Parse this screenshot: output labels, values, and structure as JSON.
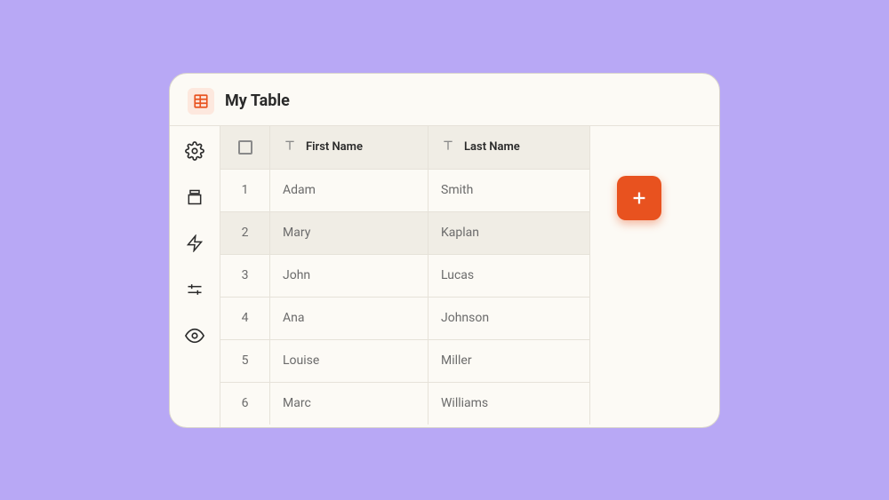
{
  "title": "My Table",
  "columns": {
    "first": "First Name",
    "last": "Last Name"
  },
  "rows": [
    {
      "num": "1",
      "first": "Adam",
      "last": "Smith",
      "highlighted": false
    },
    {
      "num": "2",
      "first": "Mary",
      "last": "Kaplan",
      "highlighted": true
    },
    {
      "num": "3",
      "first": "John",
      "last": "Lucas",
      "highlighted": false
    },
    {
      "num": "4",
      "first": "Ana",
      "last": "Johnson",
      "highlighted": false
    },
    {
      "num": "5",
      "first": "Louise",
      "last": "Miller",
      "highlighted": false
    },
    {
      "num": "6",
      "first": "Marc",
      "last": "Williams",
      "highlighted": false
    }
  ],
  "sidebar": {
    "items": [
      "settings",
      "archive",
      "automations",
      "filters",
      "visibility"
    ]
  },
  "colors": {
    "accent": "#e8521f",
    "bg": "#fcfaf5",
    "header_bg": "#f0ede5"
  }
}
